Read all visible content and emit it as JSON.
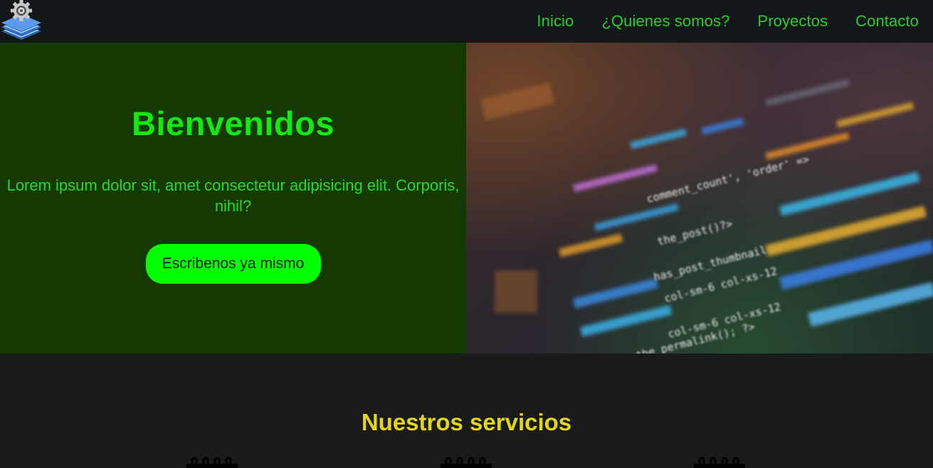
{
  "navbar": {
    "logo_icon": "gear-layers-logo",
    "links": [
      "Inicio",
      "¿Quienes somos?",
      "Proyectos",
      "Contacto"
    ]
  },
  "hero": {
    "title": "Bienvenidos",
    "text": "Lorem ipsum dolor sit, amet consectetur adipisicing elit. Corporis, nihil?",
    "button_label": "Escribenos ya mismo",
    "image": "code-on-screen-photo",
    "code_snippets": [
      "comment_count', 'order' =>",
      "the_post()?>",
      "has_post_thumbnail",
      "col-sm-6 col-xs-12",
      "col-sm-6 col-xs-12",
      "the_permalink(); ?>"
    ]
  },
  "services": {
    "title": "Nuestros servicios",
    "icons": [
      "service-icon",
      "service-icon",
      "service-icon"
    ]
  },
  "colors": {
    "navbar_bg": "#12171a",
    "nav_link": "#32c832",
    "hero_left_bg": "#143a01",
    "hero_title": "#13e913",
    "button_bg": "#02ff02",
    "services_title": "#e3d61a",
    "page_bg": "#1a1a1a"
  }
}
